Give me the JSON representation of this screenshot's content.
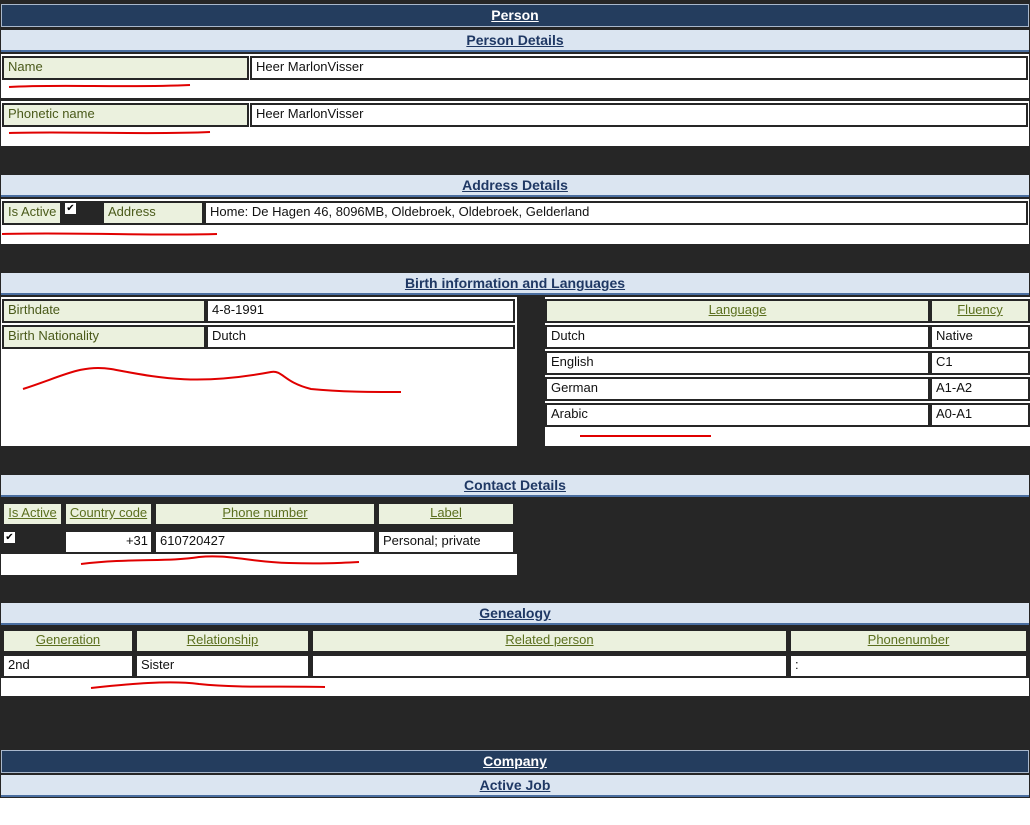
{
  "person": {
    "title": "Person",
    "details_title": "Person Details",
    "name_label": "Name",
    "name_value": "Heer MarlonVisser",
    "phonetic_label": "Phonetic name",
    "phonetic_value": "Heer MarlonVisser"
  },
  "address": {
    "title": "Address Details",
    "is_active_label": "Is Active",
    "address_label": "Address",
    "address_value": "Home: De Hagen 46, 8096MB, Oldebroek, Oldebroek, Gelderland"
  },
  "birth": {
    "title": "Birth information and Languages",
    "birthdate_label": "Birthdate",
    "birthdate_value": "4-8-1991",
    "nationality_label": "Birth Nationality",
    "nationality_value": "Dutch",
    "lang_header": "Language",
    "fluency_header": "Fluency",
    "languages": [
      {
        "language": "Dutch",
        "fluency": "Native"
      },
      {
        "language": "English",
        "fluency": "C1"
      },
      {
        "language": "German",
        "fluency": "A1-A2"
      },
      {
        "language": "Arabic",
        "fluency": "A0-A1"
      }
    ]
  },
  "contact": {
    "title": "Contact Details",
    "headers": {
      "is_active": "Is Active",
      "country_code": "Country code",
      "phone": "Phone number",
      "label": "Label"
    },
    "row": {
      "country_code": "+31",
      "phone": "610720427",
      "label": "Personal; private"
    }
  },
  "genealogy": {
    "title": "Genealogy",
    "headers": {
      "generation": "Generation",
      "relationship": "Relationship",
      "related_person": "Related person",
      "phonenumber": "Phonenumber"
    },
    "row": {
      "generation": "2nd",
      "relationship": "Sister",
      "related_person": "",
      "phonenumber": ":"
    }
  },
  "company": {
    "title": "Company",
    "active_job_title": "Active Job"
  },
  "colors": {
    "dark_bar": "#243d5e",
    "light_bar": "#dbe5f1",
    "label_bg": "#ebf1de",
    "background": "#262626",
    "annotation": "#e00000"
  }
}
